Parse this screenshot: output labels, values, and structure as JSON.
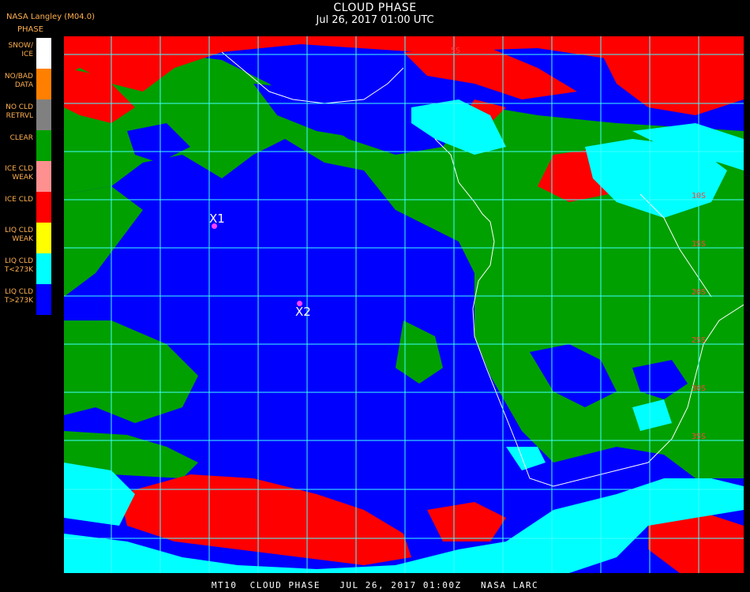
{
  "header": {
    "title": "CLOUD PHASE",
    "subtitle": "Jul 26, 2017 01:00 UTC",
    "provider": "NASA Langley (M04.0)",
    "legend_title": "PHASE"
  },
  "legend": [
    {
      "label": "SNOW/\nICE",
      "color": "#ffffff"
    },
    {
      "label": "NO/BAD\nDATA",
      "color": "#ff8000"
    },
    {
      "label": "NO CLD\nRETRVL",
      "color": "#808080"
    },
    {
      "label": "CLEAR",
      "color": "#00a000"
    },
    {
      "label": "ICE CLD\nWEAK",
      "color": "#ff9090"
    },
    {
      "label": "ICE CLD",
      "color": "#ff0000"
    },
    {
      "label": "LIQ CLD\nWEAK",
      "color": "#ffff00"
    },
    {
      "label": "LIQ CLD\nT<273K",
      "color": "#00ffff"
    },
    {
      "label": "LIQ CLD\nT>273K",
      "color": "#0000ff"
    }
  ],
  "map": {
    "lat_labels": [
      "5S",
      "10S",
      "15S",
      "20S",
      "25S",
      "30S",
      "35S"
    ],
    "markers": [
      {
        "label": "X1"
      },
      {
        "label": "X2"
      }
    ]
  },
  "footer": {
    "text": "MT10  CLOUD PHASE   JUL 26, 2017 01:00Z   NASA LARC"
  }
}
